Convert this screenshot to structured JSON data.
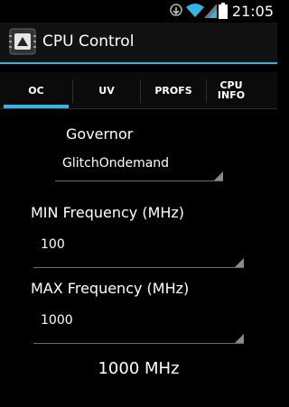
{
  "status_bar": {
    "time": "21:05",
    "icons": [
      "download-icon",
      "wifi-icon",
      "signal-icon",
      "battery-icon"
    ]
  },
  "action_bar": {
    "title": "CPU Control",
    "icon": "cpu-chip-icon"
  },
  "tabs": [
    {
      "label": "OC",
      "selected": true
    },
    {
      "label": "UV",
      "selected": false
    },
    {
      "label": "PROFS",
      "selected": false
    },
    {
      "label": "CPU INFO",
      "selected": false
    }
  ],
  "oc": {
    "governor_label": "Governor",
    "governor_value": "GlitchOndemand",
    "min_label": "MIN Frequency (MHz)",
    "min_value": "100",
    "max_label": "MAX Frequency (MHz)",
    "max_value": "1000",
    "current_frequency": "1000 MHz"
  },
  "colors": {
    "accent": "#33b5e5",
    "background": "#000000",
    "action_bar": "#121212"
  }
}
